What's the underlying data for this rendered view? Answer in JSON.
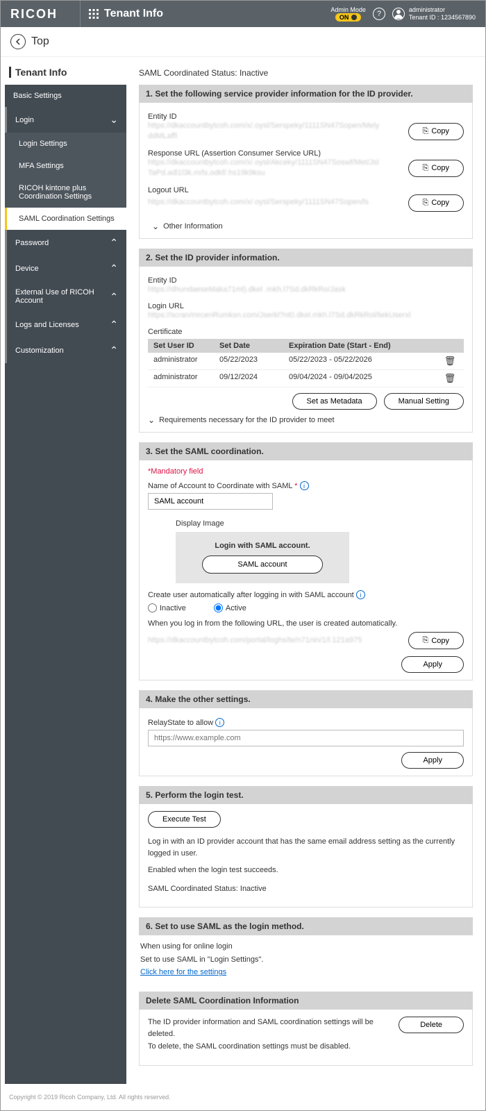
{
  "header": {
    "brand": "RICOH",
    "pageTitle": "Tenant Info",
    "adminModeLabel": "Admin Mode",
    "adminModeState": "ON",
    "userName": "administrator",
    "tenantId": "Tenant ID : 1234567890"
  },
  "breadcrumb": {
    "top": "Top"
  },
  "sidebar": {
    "title": "Tenant Info",
    "basic": "Basic Settings",
    "login": "Login",
    "loginSettings": "Login Settings",
    "mfa": "MFA Settings",
    "kintone": "RICOH kintone plus Coordination Settings",
    "saml": "SAML Coordination Settings",
    "password": "Password",
    "device": "Device",
    "external": "External Use of RICOH Account",
    "logs": "Logs and Licenses",
    "custom": "Customization"
  },
  "main": {
    "statusLabel": "SAML Coordinated Status: Inactive",
    "s1": {
      "header": "1. Set the following service provider information for the ID provider.",
      "entityIdLabel": "Entity ID",
      "entityIdVal": "https://dkaccountbytcoh.com/x/.oysl/Serspeky/1111SN47Sopen/Mely ddMLaffI",
      "responseLabel": "Response URL (Assertion Consumer Service URL)",
      "responseVal": "https://dkaccountbytcoh.com/x/.oysl/Akceky/1111SN47Soswf/Met/Jsl TaPd.adl1l3k.m/ls.odkf/.hs19k9ksu",
      "logoutLabel": "Logout URL",
      "logoutVal": "https://dkaccountbytcoh.com/x/.oysl/Serspeky/1111SN47Sopen/ls",
      "copy": "Copy",
      "otherInfo": "Other Information"
    },
    "s2": {
      "header": "2. Set the ID provider information.",
      "entityIdLabel": "Entity ID",
      "entityIdVal": "https://dhundaeseMaka71ml).dkel .mkh.l7Sd.dkRkRo/Jask",
      "loginUrlLabel": "Login URL",
      "loginUrlVal": "https://scran/mrcenRumksn.com/Jserkl?nt0.dkel.mkh.l7Sd.dkRkRol/liekUserxl",
      "certLabel": "Certificate",
      "col1": "Set User ID",
      "col2": "Set Date",
      "col3": "Expiration Date (Start - End)",
      "rows": [
        {
          "user": "administrator",
          "date": "05/22/2023",
          "exp": "05/22/2023 - 05/22/2026"
        },
        {
          "user": "administrator",
          "date": "09/12/2024",
          "exp": "09/04/2024 - 09/04/2025"
        }
      ],
      "setMeta": "Set as Metadata",
      "manual": "Manual Setting",
      "reqText": "Requirements necessary for the ID provider to meet"
    },
    "s3": {
      "header": "3. Set the SAML coordination.",
      "mandatory": "Mandatory field",
      "nameLabel": "Name of Account to Coordinate with SAML",
      "nameVal": "SAML account",
      "displayImage": "Display Image",
      "previewText": "Login with SAML account.",
      "previewBtn": "SAML account",
      "autoCreateLabel": "Create user automatically after logging in with SAML account",
      "inactive": "Inactive",
      "active": "Active",
      "autoNote": "When you log in from the following URL, the user is created automatically.",
      "autoUrl": "https://dkaccountbytcoh.com/portal/loghs/te/n71nin/1/l.121a975",
      "copy": "Copy",
      "apply": "Apply"
    },
    "s4": {
      "header": "4. Make the other settings.",
      "relayLabel": "RelayState to allow",
      "placeholder": "https://www.example.com",
      "apply": "Apply"
    },
    "s5": {
      "header": "5. Perform the login test.",
      "execBtn": "Execute Test",
      "desc1": "Log in with an ID provider account that has the same email address setting as the currently logged in user.",
      "desc2": "Enabled when the login test succeeds.",
      "status": "SAML Coordinated Status: Inactive"
    },
    "s6": {
      "header": "6. Set to use SAML as the login method.",
      "line1": "When using for online login",
      "line2": "Set to use SAML in \"Login Settings\".",
      "link": "Click here for the settings"
    },
    "delete": {
      "header": "Delete SAML Coordination Information",
      "line1": "The ID provider information and SAML coordination settings will be deleted.",
      "line2": "To delete, the SAML coordination settings must be disabled.",
      "btn": "Delete"
    }
  },
  "footer": "Copyright © 2019 Ricoh Company, Ltd. All rights reserved."
}
